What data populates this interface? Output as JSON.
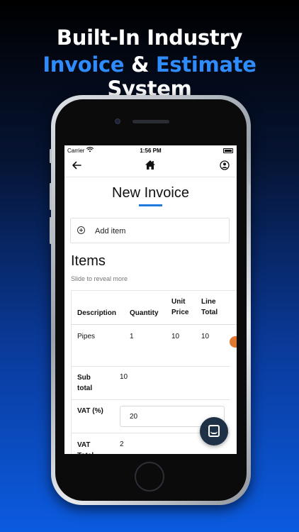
{
  "promo": {
    "line1": "Built-In Industry",
    "line2_a": "Invoice",
    "line2_and": "&",
    "line2_b": "Estimate",
    "line2_c": "System"
  },
  "status_bar": {
    "carrier": "Carrier",
    "time": "1:56 PM"
  },
  "nav": {
    "back_icon": "arrow-left-icon",
    "home_icon": "home-icon",
    "profile_icon": "user-circle-icon"
  },
  "page": {
    "title": "New Invoice"
  },
  "add_item": {
    "label": "Add item",
    "icon": "plus-circle-icon"
  },
  "items": {
    "heading": "Items",
    "hint": "Slide to reveal more",
    "columns": [
      "Description",
      "Quantity",
      "Unit Price",
      "Line Total"
    ],
    "rows": [
      {
        "description": "Pipes",
        "quantity": "1",
        "unit_price": "10",
        "line_total": "10"
      }
    ]
  },
  "summary": {
    "subtotal_label": "Sub total",
    "subtotal_value": "10",
    "vat_label": "VAT (%)",
    "vat_value": "20",
    "vat_total_label": "VAT Total",
    "vat_total_value": "2"
  },
  "colors": {
    "accent": "#2f8cff",
    "underline": "#1f7ae0",
    "chat_button": "#1e3147",
    "action_orange": "#e0782f"
  }
}
